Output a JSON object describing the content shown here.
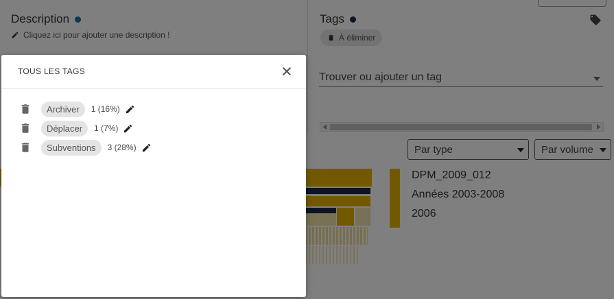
{
  "description": {
    "title": "Description",
    "dot_color": "#1a6fa0",
    "add_link": "Cliquez ici pour ajouter une description !"
  },
  "tags_panel": {
    "title": "Tags",
    "dot_color": "#1b2a4a",
    "current_tag": "À éliminer",
    "search_placeholder": "Trouver ou ajouter un tag"
  },
  "filters": {
    "type_select": "Par type",
    "volume_select": "Par volume"
  },
  "tree": {
    "items": [
      "DPM_2009_012",
      "Années 2003-2008",
      "2006"
    ]
  },
  "colors": {
    "accent_yellow": "#e5b300",
    "navy": "#1b2a4a"
  },
  "modal": {
    "title": "TOUS LES TAGS",
    "tags": [
      {
        "label": "Archiver",
        "count": "1 (16%)"
      },
      {
        "label": "Déplacer",
        "count": "1 (7%)"
      },
      {
        "label": "Subventions",
        "count": "3 (28%)"
      }
    ]
  }
}
